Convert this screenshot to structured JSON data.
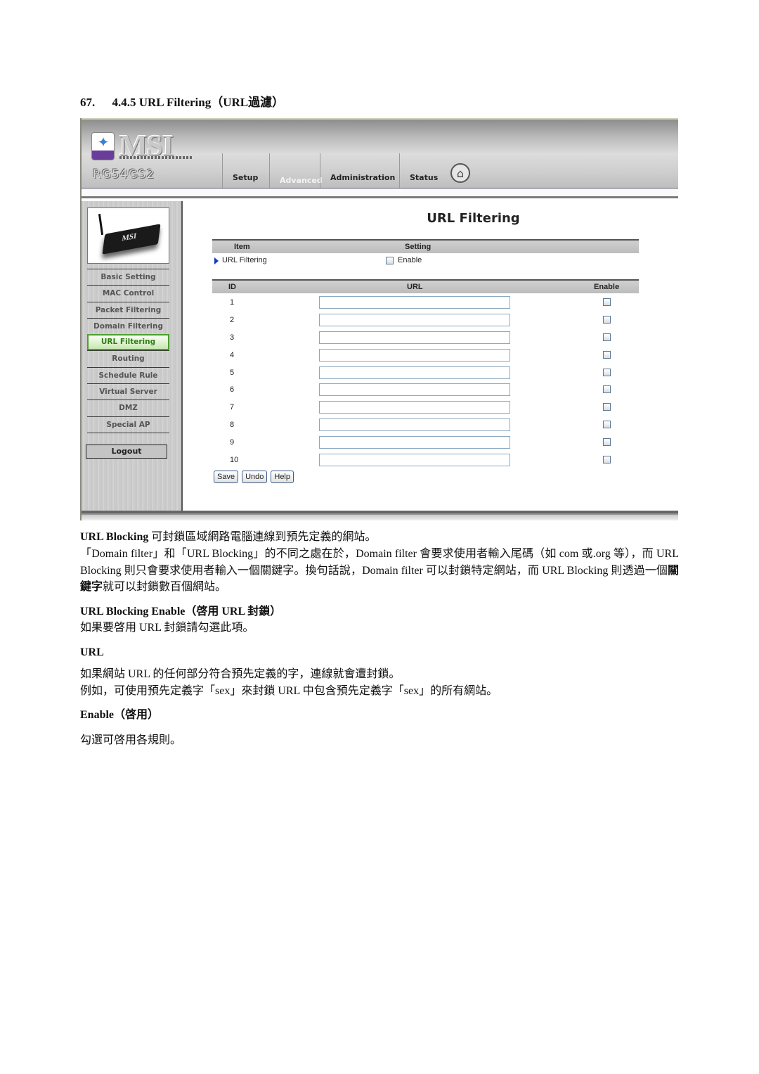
{
  "section_heading": {
    "number": "67.",
    "title": "4.4.5 URL Filtering（URL過濾）"
  },
  "router_ui": {
    "brand": "MSI",
    "model": "RG54GS2",
    "tabs": [
      {
        "label": "Setup",
        "active": false
      },
      {
        "label": "Advanced",
        "active": true
      },
      {
        "label": "Administration",
        "active": false
      },
      {
        "label": "Status",
        "active": false
      }
    ],
    "home_icon": "home-icon",
    "device_label": "MSI",
    "sidebar": {
      "items": [
        {
          "label": "Basic Setting",
          "active": false
        },
        {
          "label": "MAC Control",
          "active": false
        },
        {
          "label": "Packet Filtering",
          "active": false
        },
        {
          "label": "Domain Filtering",
          "active": false
        },
        {
          "label": "URL Filtering",
          "active": true
        },
        {
          "label": "Routing",
          "active": false
        },
        {
          "label": "Schedule Rule",
          "active": false
        },
        {
          "label": "Virtual Server",
          "active": false
        },
        {
          "label": "DMZ",
          "active": false
        },
        {
          "label": "Special AP",
          "active": false
        }
      ],
      "logout_label": "Logout"
    },
    "page_title": "URL Filtering",
    "settings_table": {
      "headers": {
        "item": "Item",
        "setting": "Setting"
      },
      "row_label": "URL Filtering",
      "enable_label": "Enable",
      "enabled": false
    },
    "url_table": {
      "headers": {
        "id": "ID",
        "url": "URL",
        "enable": "Enable"
      },
      "rows": [
        {
          "id": "1",
          "url": "",
          "enabled": false
        },
        {
          "id": "2",
          "url": "",
          "enabled": false
        },
        {
          "id": "3",
          "url": "",
          "enabled": false
        },
        {
          "id": "4",
          "url": "",
          "enabled": false
        },
        {
          "id": "5",
          "url": "",
          "enabled": false
        },
        {
          "id": "6",
          "url": "",
          "enabled": false
        },
        {
          "id": "7",
          "url": "",
          "enabled": false
        },
        {
          "id": "8",
          "url": "",
          "enabled": false
        },
        {
          "id": "9",
          "url": "",
          "enabled": false
        },
        {
          "id": "10",
          "url": "",
          "enabled": false
        }
      ]
    },
    "buttons": {
      "save": "Save",
      "undo": "Undo",
      "help": "Help"
    },
    "colors": {
      "active_menu_text": "#2f7d14",
      "active_menu_border": "#4aa02c",
      "bullet_arrow": "#1838c8"
    }
  },
  "document": {
    "intro_bold": "URL Blocking",
    "intro_rest": " 可封鎖區域網路電腦連線到預先定義的網站。",
    "para2_a": "「Domain filter」和「URL Blocking」的不同之處在於，Domain filter 會要求使用者輸入尾碼（如 com 或.org 等），而 URL  Blocking 則只會要求使用者輸入一個關鍵字。換句話說，Domain  filter 可以封鎖特定網站，而 URL Blocking 則透過一個",
    "para2_bold": "關鍵字",
    "para2_b": "就可以封鎖數百個網站。",
    "enable_heading": "URL Blocking Enable（啓用 URL 封鎖）",
    "enable_text": "如果要啓用 URL 封鎖請勾選此項。",
    "url_heading": "URL",
    "url_text_1": "如果網站 URL 的任何部分符合預先定義的字，連線就會遭封鎖。",
    "url_text_2": "例如，可使用預先定義字「sex」來封鎖 URL 中包含預先定義字「sex」的所有網站。",
    "enable2_heading": "Enable（啓用）",
    "enable2_text": "勾選可啓用各規則。"
  }
}
